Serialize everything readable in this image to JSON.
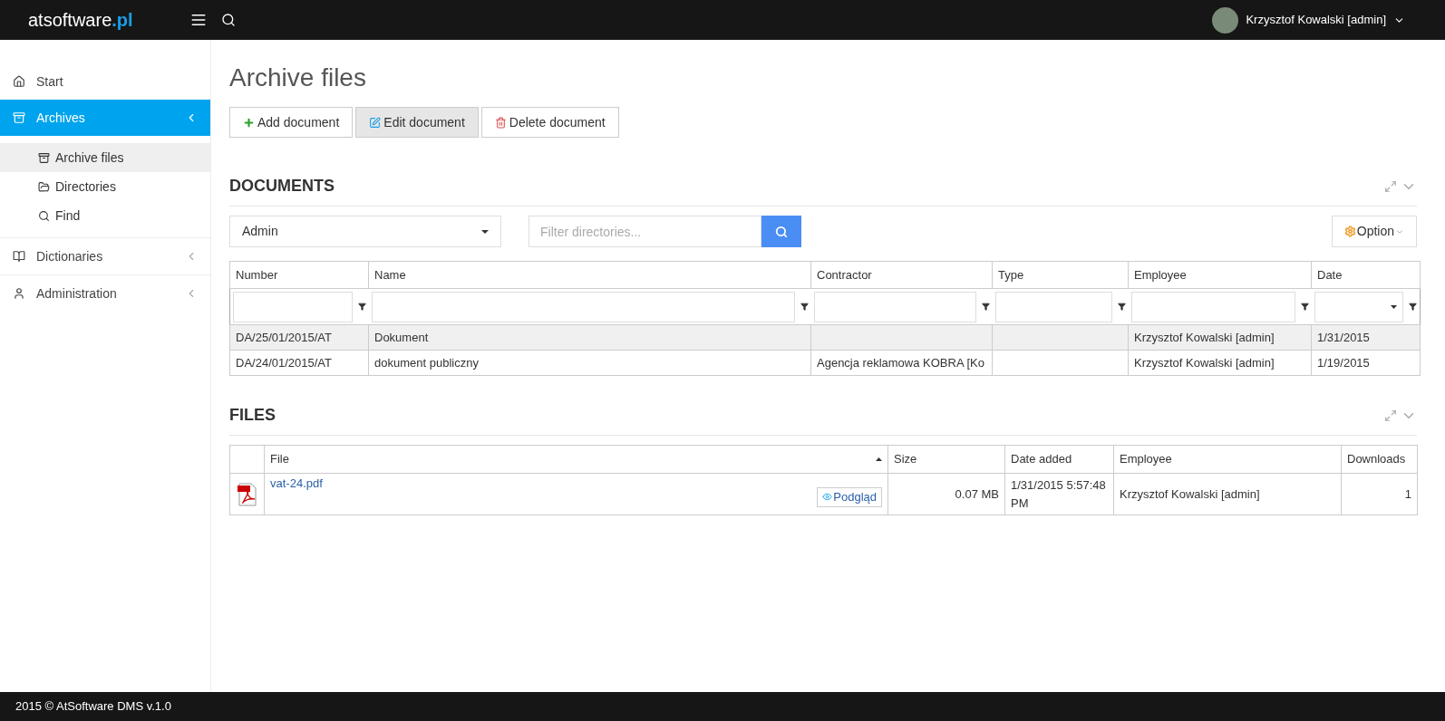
{
  "header": {
    "brand": {
      "name": "atsoftware",
      "suffix": ".pl"
    },
    "user": "Krzysztof Kowalski [admin]"
  },
  "sidebar": {
    "items": [
      {
        "kind": "home",
        "label": "Start",
        "selected": false
      },
      {
        "kind": "archive",
        "label": "Archives",
        "selected": true,
        "expanded": true,
        "children": [
          {
            "kind": "archive",
            "label": "Archive files",
            "selected": true
          },
          {
            "kind": "folder",
            "label": "Directories",
            "selected": false
          },
          {
            "kind": "search",
            "label": "Find",
            "selected": false
          }
        ]
      },
      {
        "kind": "book",
        "label": "Dictionaries",
        "selected": false,
        "submenu": true
      },
      {
        "kind": "user",
        "label": "Administration",
        "selected": false,
        "submenu": true
      }
    ]
  },
  "page_title": "Archive files",
  "toolbar": [
    {
      "kind": "add",
      "label": "Add document",
      "pressed": false
    },
    {
      "kind": "edit",
      "label": "Edit document",
      "pressed": true
    },
    {
      "kind": "delete",
      "label": "Delete document",
      "pressed": false
    }
  ],
  "documents": {
    "title": "DOCUMENTS",
    "user_select": "Admin",
    "filter": {
      "placeholder": "Filter directories..."
    },
    "options_button": "Option",
    "table": {
      "columns": [
        {
          "label": "Number",
          "kind": "text"
        },
        {
          "label": "Name",
          "kind": "text"
        },
        {
          "label": "Contractor",
          "kind": "text"
        },
        {
          "label": "Type",
          "kind": "text"
        },
        {
          "label": "Employee",
          "kind": "text"
        },
        {
          "label": "Date",
          "kind": "select"
        }
      ],
      "rows": [
        {
          "selected": true,
          "cells": [
            "DA/25/01/2015/AT",
            "Dokument",
            "",
            "",
            "Krzysztof Kowalski [admin]",
            "1/31/2015"
          ]
        },
        {
          "selected": false,
          "cells": [
            "DA/24/01/2015/AT",
            "dokument publiczny",
            "Agencja reklamowa KOBRA [Ko",
            "",
            "Krzysztof Kowalski [admin]",
            "1/19/2015"
          ]
        }
      ]
    }
  },
  "files": {
    "title": "FILES",
    "table": {
      "columns": [
        {
          "label": "File",
          "sorted": true
        },
        {
          "label": "Size",
          "sorted": false
        },
        {
          "label": "Date added",
          "sorted": false
        },
        {
          "label": "Employee",
          "sorted": false
        },
        {
          "label": "Downloads",
          "sorted": false
        }
      ],
      "rows": [
        {
          "file": "vat-24.pdf",
          "preview": "Podgląd",
          "size": "0.07 MB",
          "date_added": "1/31/2015 5:57:48 PM",
          "employee": "Krzysztof Kowalski [admin]",
          "downloads": "1"
        }
      ]
    }
  },
  "footer": "2015 © AtSoftware DMS v.1.0"
}
